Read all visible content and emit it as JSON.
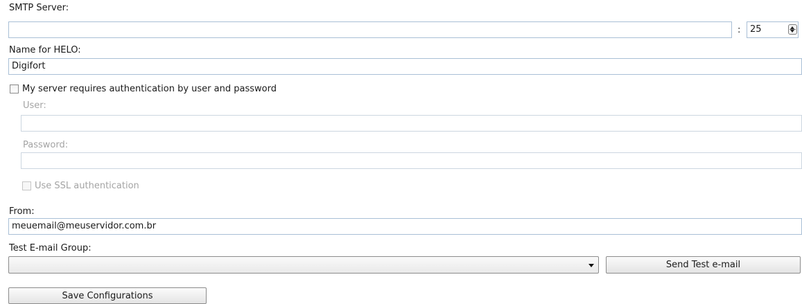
{
  "smtp": {
    "server_label": "SMTP Server:",
    "server_value": "",
    "port_separator": ":",
    "port_value": "25"
  },
  "helo": {
    "label": "Name for HELO:",
    "value": "Digifort"
  },
  "auth": {
    "checkbox_label": "My server requires authentication by user and password",
    "checked": false,
    "user_label": "User:",
    "user_value": "",
    "password_label": "Password:",
    "password_value": "",
    "ssl_label": "Use SSL authentication",
    "ssl_checked": false
  },
  "from": {
    "label": "From:",
    "value": "meuemail@meuservidor.com.br"
  },
  "test_group": {
    "label": "Test E-mail Group:",
    "selected": ""
  },
  "buttons": {
    "send_test": "Send Test e-mail",
    "save": "Save Configurations"
  },
  "icons": {
    "port_spinner": "spinner-icon",
    "dropdown": "chevron-down-icon"
  }
}
